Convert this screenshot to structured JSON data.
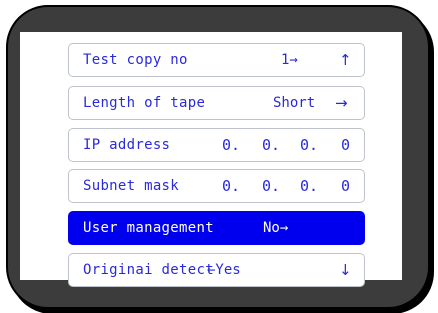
{
  "menu": {
    "test_copy_no": {
      "label": "Test copy no",
      "value": "1→",
      "scroll_icon": "↑"
    },
    "length_of_tape": {
      "label": "Length of tape",
      "value": "Short",
      "arrow": "→"
    },
    "ip_address": {
      "label": "IP address",
      "octets": [
        "0.",
        "0.",
        "0.",
        "0"
      ]
    },
    "subnet_mask": {
      "label": "Subnet mask",
      "octets": [
        "0.",
        "0.",
        "0.",
        "0"
      ]
    },
    "user_management": {
      "label": "User management",
      "value": "No→"
    },
    "original_detect": {
      "label": "Originai detect",
      "value": "←Yes",
      "scroll_icon": "↓"
    }
  },
  "colors": {
    "text": "#2a2adc",
    "selected_bg": "#0000ee",
    "selected_text": "#ffffff",
    "bezel": "#3c3c3c",
    "row_border": "#bfc3cc"
  },
  "icons": {
    "up": "arrow-up-icon",
    "down": "arrow-down-icon",
    "right": "arrow-right-icon",
    "left": "arrow-left-icon"
  }
}
